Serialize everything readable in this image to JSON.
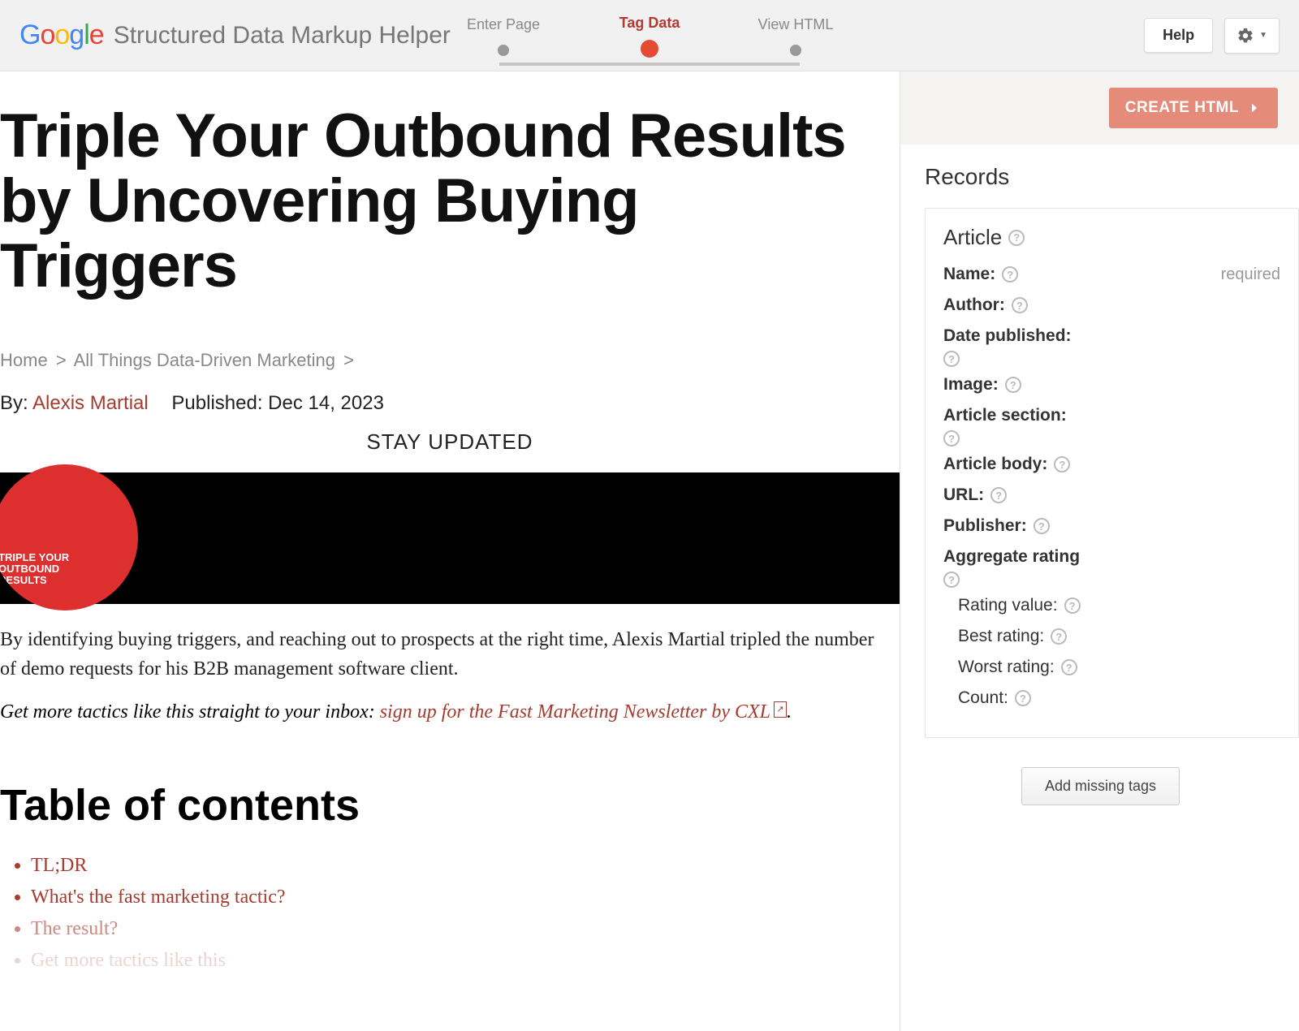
{
  "header": {
    "product_name": "Structured Data Markup Helper",
    "steps": [
      "Enter Page",
      "Tag Data",
      "View HTML"
    ],
    "active_step_index": 1,
    "help_label": "Help"
  },
  "article": {
    "title": "Triple Your Outbound Results by Uncovering Buying Triggers",
    "breadcrumb": {
      "home": "Home",
      "section": "All Things Data-Driven Marketing"
    },
    "by_label": "By:",
    "author": "Alexis Martial",
    "published_label": "Published:",
    "published_date": "Dec 14, 2023",
    "stay_updated": "STAY UPDATED",
    "hero_overlay": "TRIPLE YOUR\nOUTBOUND RESULTS",
    "intro": "By identifying buying triggers, and reaching out to prospects at the right time, Alexis Martial tripled the number of demo requests for his B2B management software client.",
    "cta_prefix": "Get more tactics like this straight to your inbox: ",
    "cta_link_text": "sign up for the Fast Marketing Newsletter by CXL",
    "cta_suffix": ".",
    "toc_heading": "Table of contents",
    "toc": [
      "TL;DR",
      "What's the fast marketing tactic?",
      "The result?",
      "Get more tactics like this"
    ]
  },
  "sidebar": {
    "create_label": "CREATE HTML",
    "records_heading": "Records",
    "card_title": "Article",
    "fields": {
      "name": "Name:",
      "name_required": "required",
      "author": "Author:",
      "date_published": "Date published:",
      "image": "Image:",
      "article_section": "Article section:",
      "article_body": "Article body:",
      "url": "URL:",
      "publisher": "Publisher:",
      "aggregate_rating": "Aggregate rating",
      "rating_value": "Rating value:",
      "best_rating": "Best rating:",
      "worst_rating": "Worst rating:",
      "count": "Count:"
    },
    "add_missing_label": "Add missing tags"
  }
}
